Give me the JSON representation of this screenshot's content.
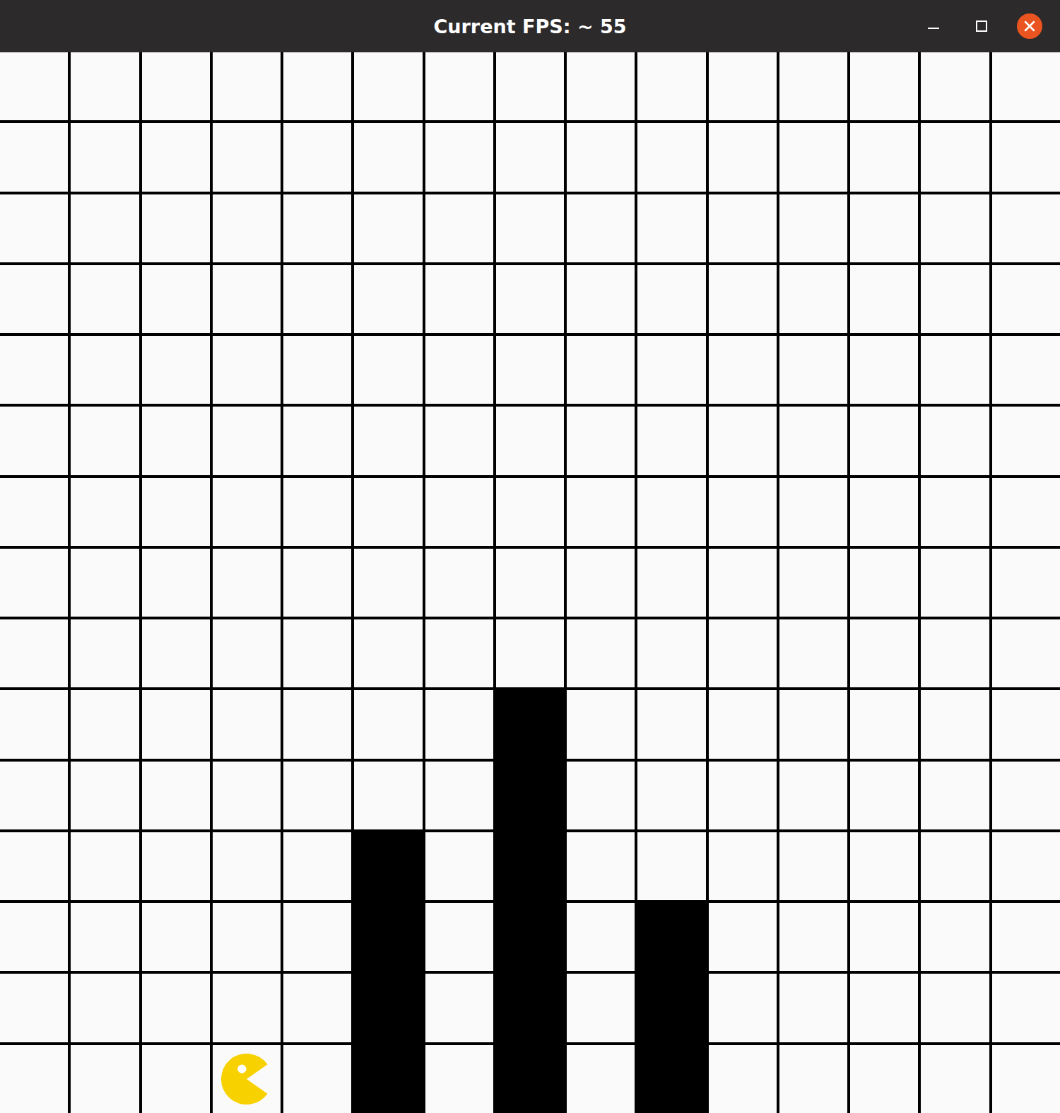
{
  "window": {
    "title": "Current FPS: ~ 55"
  },
  "board": {
    "pacman": {
      "facing": "right"
    },
    "rows": [
      [
        "empty",
        "empty",
        "empty",
        "empty",
        "empty",
        "empty",
        "empty",
        "empty",
        "empty",
        "empty",
        "empty",
        "empty",
        "empty",
        "empty",
        "empty"
      ],
      [
        "empty",
        "empty",
        "empty",
        "empty",
        "empty",
        "empty",
        "empty",
        "empty",
        "empty",
        "empty",
        "empty",
        "empty",
        "empty",
        "empty",
        "empty"
      ],
      [
        "empty",
        "empty",
        "empty",
        "empty",
        "empty",
        "empty",
        "empty",
        "empty",
        "empty",
        "empty",
        "empty",
        "empty",
        "empty",
        "empty",
        "empty"
      ],
      [
        "empty",
        "empty",
        "empty",
        "empty",
        "empty",
        "empty",
        "empty",
        "empty",
        "empty",
        "empty",
        "empty",
        "empty",
        "empty",
        "empty",
        "empty"
      ],
      [
        "empty",
        "empty",
        "empty",
        "empty",
        "empty",
        "empty",
        "empty",
        "empty",
        "empty",
        "empty",
        "empty",
        "empty",
        "empty",
        "empty",
        "empty"
      ],
      [
        "empty",
        "empty",
        "empty",
        "empty",
        "empty",
        "empty",
        "empty",
        "empty",
        "empty",
        "empty",
        "empty",
        "empty",
        "empty",
        "empty",
        "empty"
      ],
      [
        "empty",
        "empty",
        "empty",
        "empty",
        "empty",
        "empty",
        "empty",
        "empty",
        "empty",
        "empty",
        "empty",
        "empty",
        "empty",
        "empty",
        "empty"
      ],
      [
        "empty",
        "empty",
        "empty",
        "empty",
        "empty",
        "empty",
        "empty",
        "empty",
        "empty",
        "empty",
        "empty",
        "empty",
        "empty",
        "empty",
        "empty"
      ],
      [
        "empty",
        "empty",
        "empty",
        "empty",
        "empty",
        "empty",
        "empty",
        "empty",
        "empty",
        "empty",
        "empty",
        "empty",
        "empty",
        "empty",
        "empty"
      ],
      [
        "empty",
        "empty",
        "empty",
        "empty",
        "empty",
        "empty",
        "empty",
        "wall",
        "empty",
        "empty",
        "empty",
        "empty",
        "empty",
        "empty",
        "empty"
      ],
      [
        "empty",
        "empty",
        "empty",
        "empty",
        "empty",
        "empty",
        "empty",
        "wall",
        "empty",
        "empty",
        "empty",
        "empty",
        "empty",
        "empty",
        "empty"
      ],
      [
        "empty",
        "empty",
        "empty",
        "empty",
        "empty",
        "wall",
        "empty",
        "wall",
        "empty",
        "empty",
        "empty",
        "empty",
        "empty",
        "empty",
        "empty"
      ],
      [
        "empty",
        "empty",
        "empty",
        "empty",
        "empty",
        "wall",
        "empty",
        "wall",
        "empty",
        "wall",
        "empty",
        "empty",
        "empty",
        "empty",
        "empty"
      ],
      [
        "empty",
        "empty",
        "empty",
        "empty",
        "empty",
        "wall",
        "empty",
        "wall",
        "empty",
        "wall",
        "empty",
        "empty",
        "empty",
        "empty",
        "empty"
      ],
      [
        "empty",
        "empty",
        "empty",
        "pacman",
        "empty",
        "wall",
        "empty",
        "wall",
        "empty",
        "wall",
        "empty",
        "empty",
        "empty",
        "empty",
        "empty"
      ]
    ]
  }
}
